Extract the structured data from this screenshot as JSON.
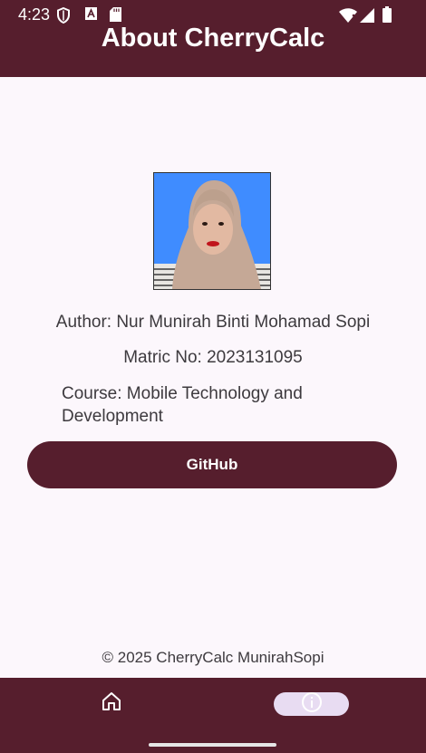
{
  "status_bar": {
    "time": "4:23",
    "icons": [
      "shield-icon",
      "font-icon",
      "sd-card-icon",
      "wifi-icon",
      "signal-icon",
      "battery-icon"
    ]
  },
  "header": {
    "title": "About CherryCalc"
  },
  "profile": {
    "photo_alt": "Author photo",
    "author": "Author: Nur Munirah Binti Mohamad Sopi",
    "matric": "Matric No: 2023131095",
    "course": "Course: Mobile Technology and Development"
  },
  "actions": {
    "github_label": "GitHub"
  },
  "footer": {
    "copyright": "© 2025 CherryCalc MunirahSopi"
  },
  "bottom_nav": {
    "items": [
      {
        "icon": "home-icon",
        "selected": false
      },
      {
        "icon": "info-icon",
        "selected": true
      }
    ]
  },
  "colors": {
    "primary": "#561e2d",
    "background": "#fcf7fc",
    "selected_indicator": "#e8dcf2",
    "photo_background": "#3f8cff"
  }
}
